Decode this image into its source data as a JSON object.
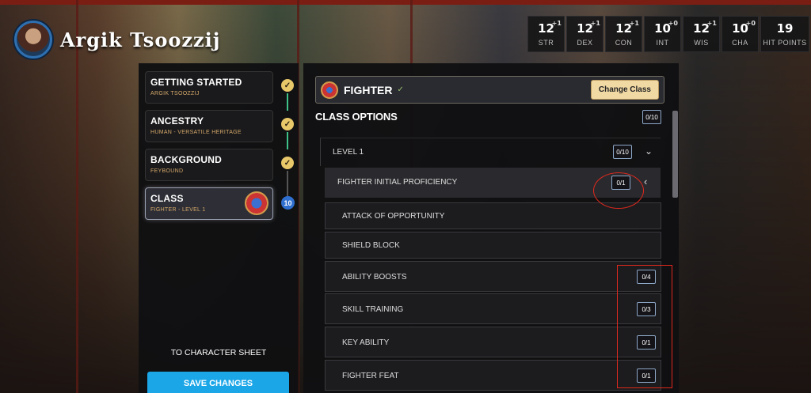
{
  "character": {
    "name": "Argik Tsoozzij"
  },
  "stats": [
    {
      "value": "12",
      "mod": "+1",
      "label": "STR"
    },
    {
      "value": "12",
      "mod": "+1",
      "label": "DEX"
    },
    {
      "value": "12",
      "mod": "+1",
      "label": "CON"
    },
    {
      "value": "10",
      "mod": "+0",
      "label": "INT"
    },
    {
      "value": "12",
      "mod": "+1",
      "label": "WIS"
    },
    {
      "value": "10",
      "mod": "+0",
      "label": "CHA"
    },
    {
      "value": "19",
      "mod": "",
      "label": "HIT POINTS"
    }
  ],
  "steps": [
    {
      "title": "GETTING STARTED",
      "sub": "ARGIK TSOOZZIJ"
    },
    {
      "title": "ANCESTRY",
      "sub": "HUMAN - VERSATILE HERITAGE"
    },
    {
      "title": "BACKGROUND",
      "sub": "FEYBOUND"
    },
    {
      "title": "CLASS",
      "sub": "FIGHTER - LEVEL 1",
      "level": "10"
    }
  ],
  "sidebar": {
    "to_sheet": "TO CHARACTER SHEET",
    "save": "SAVE CHANGES"
  },
  "class_header": {
    "name": "FIGHTER",
    "check": "✓",
    "change_btn": "Change Class"
  },
  "options": {
    "title": "CLASS OPTIONS",
    "total": "0/10",
    "level": {
      "label": "LEVEL 1",
      "count": "0/10"
    },
    "proficiency": {
      "label": "FIGHTER INITIAL PROFICIENCY",
      "count": "0/1"
    },
    "items": [
      {
        "label": "ATTACK OF OPPORTUNITY",
        "count": ""
      },
      {
        "label": "SHIELD BLOCK",
        "count": ""
      },
      {
        "label": "ABILITY BOOSTS",
        "count": "0/4"
      },
      {
        "label": "SKILL TRAINING",
        "count": "0/3"
      },
      {
        "label": "KEY ABILITY",
        "count": "0/1"
      },
      {
        "label": "FIGHTER FEAT",
        "count": "0/1"
      }
    ]
  },
  "colors": {
    "accent": "#1ba6e8",
    "check": "#e9c86a",
    "progress": "#3fc28a",
    "highlight": "#e0281c"
  }
}
